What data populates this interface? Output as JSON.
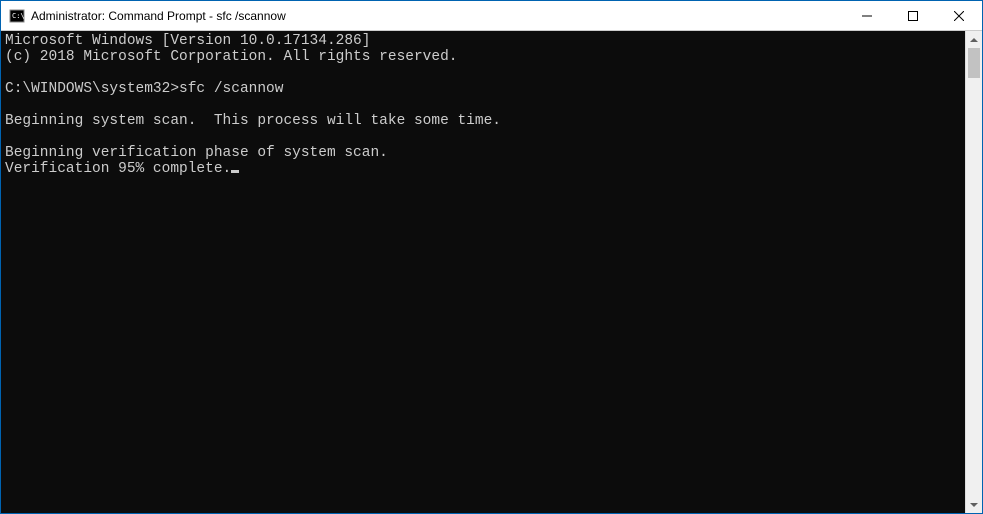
{
  "window": {
    "title": "Administrator: Command Prompt - sfc  /scannow"
  },
  "console": {
    "line_version": "Microsoft Windows [Version 10.0.17134.286]",
    "line_copyright": "(c) 2018 Microsoft Corporation. All rights reserved.",
    "prompt_path": "C:\\WINDOWS\\system32>",
    "prompt_command": "sfc /scannow",
    "line_begin_scan": "Beginning system scan.  This process will take some time.",
    "line_begin_verify": "Beginning verification phase of system scan.",
    "line_progress": "Verification 95% complete."
  }
}
